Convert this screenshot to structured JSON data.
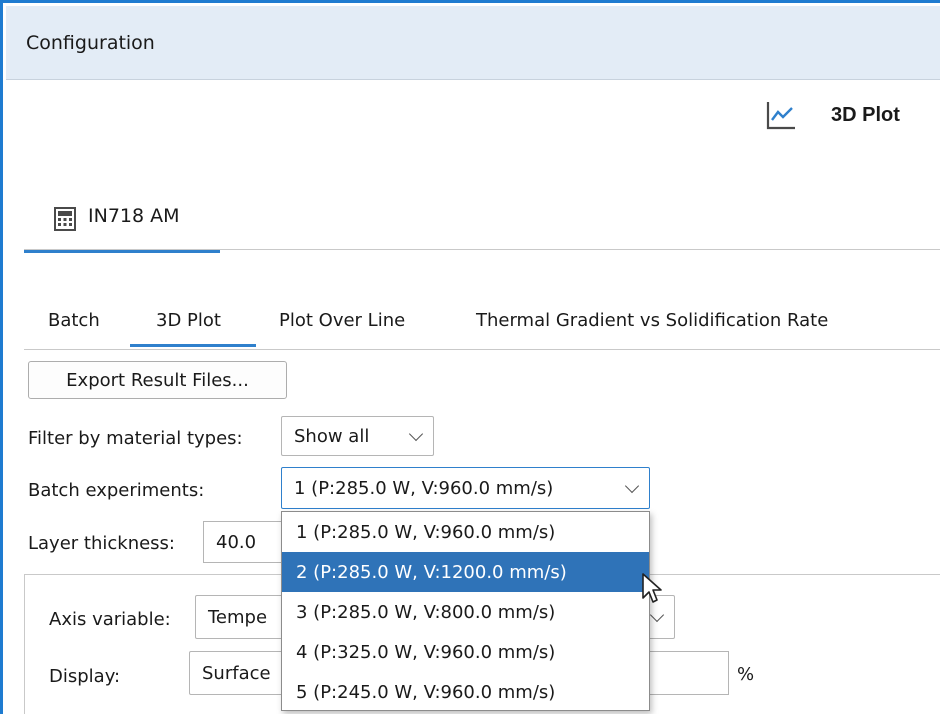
{
  "window": {
    "title": "Configuration"
  },
  "plot_header": {
    "title": "3D Plot",
    "icon": "line-chart-icon"
  },
  "calculator_tab": {
    "label": "IN718 AM",
    "icon": "calculator-icon"
  },
  "subtabs": [
    {
      "label": "Batch"
    },
    {
      "label": "3D Plot",
      "active": true
    },
    {
      "label": "Plot Over Line"
    },
    {
      "label": "Thermal Gradient vs Solidification Rate"
    }
  ],
  "export_button": {
    "label": "Export Result Files..."
  },
  "filter": {
    "label": "Filter by material types:",
    "value": "Show all"
  },
  "batch": {
    "label": "Batch experiments:",
    "value": "1 (P:285.0 W, V:960.0 mm/s)",
    "options": [
      "1 (P:285.0 W, V:960.0 mm/s)",
      "2 (P:285.0 W, V:1200.0 mm/s)",
      "3 (P:285.0 W, V:800.0 mm/s)",
      "4 (P:325.0 W, V:960.0 mm/s)",
      "5 (P:245.0 W, V:960.0 mm/s)"
    ],
    "highlighted_index": 1
  },
  "layer_thickness": {
    "label": "Layer thickness:",
    "value": "40.0"
  },
  "axis_variable": {
    "label": "Axis variable:",
    "value": "Tempe"
  },
  "display": {
    "label": "Display:",
    "value": "Surface",
    "unit": "%"
  },
  "colors": {
    "accent": "#2f80cc",
    "title_bar": "#e3ecf6",
    "selection": "#2f73b8"
  }
}
